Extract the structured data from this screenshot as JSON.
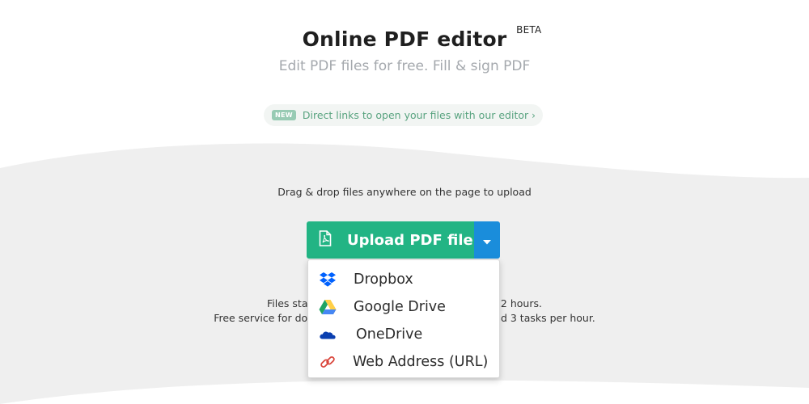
{
  "header": {
    "title": "Online PDF editor",
    "beta": "BETA",
    "subtitle": "Edit PDF files for free. Fill & sign PDF"
  },
  "notice": {
    "badge": "NEW",
    "text": "Direct links to open your files with our editor",
    "chevron": "›"
  },
  "upload": {
    "drag_text": "Drag & drop files anywhere on the page to upload",
    "button_label": "Upload PDF file",
    "icon": "pdf-file-icon",
    "dropdown_icon": "caret-down-icon"
  },
  "info": {
    "line1": "Files stay private. Automatically deleted after 2 hours.",
    "line2": "Free service for documents up to 200 pages or 50 Mb and 3 tasks per hour."
  },
  "menu": {
    "items": [
      {
        "label": "Dropbox",
        "icon": "dropbox-icon",
        "color": "#0061fe"
      },
      {
        "label": "Google Drive",
        "icon": "google-drive-icon",
        "color": "#1fa463"
      },
      {
        "label": "OneDrive",
        "icon": "onedrive-icon",
        "color": "#0a3fb0"
      },
      {
        "label": "Web Address (URL)",
        "icon": "link-icon",
        "color": "#d9453b"
      }
    ]
  },
  "colors": {
    "upload_green": "#22b484",
    "dropdown_blue": "#1a8ddb",
    "notice_text": "#58a37f",
    "background_gray": "#efefef"
  }
}
